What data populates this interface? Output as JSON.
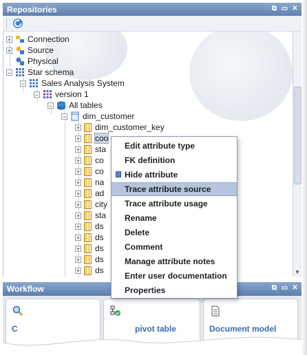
{
  "repositories_panel": {
    "title": "Repositories"
  },
  "tree": {
    "nodes": [
      {
        "label": "Connection",
        "icon": "connection-icon"
      },
      {
        "label": "Source",
        "icon": "source-icon"
      },
      {
        "label": "Physical",
        "icon": "physical-icon"
      },
      {
        "label": "Star schema",
        "icon": "star-schema-icon"
      },
      {
        "label": "Sales Analysis System",
        "icon": "star-schema-icon"
      },
      {
        "label": "version 1",
        "icon": "version-icon"
      },
      {
        "label": "All tables",
        "icon": "tables-icon"
      },
      {
        "label": "dim_customer",
        "icon": "table-icon"
      }
    ],
    "columns": [
      "dim_customer_key",
      "coo",
      "sta",
      "co",
      "co",
      "na",
      "ad",
      "city",
      "sta",
      "ds",
      "ds",
      "ds",
      "ds",
      "ds"
    ]
  },
  "context_menu": {
    "items": [
      {
        "label": "Edit attribute type"
      },
      {
        "label": "FK definition"
      },
      {
        "label": "Hide attribute",
        "icon": "hide-attribute-icon"
      },
      {
        "label": "Trace attribute source",
        "highlighted": true
      },
      {
        "label": "Trace attribute usage"
      },
      {
        "label": "Rename"
      },
      {
        "label": "Delete"
      },
      {
        "label": "Comment"
      },
      {
        "label": "Manage attribute notes"
      },
      {
        "label": "Enter user documentation"
      },
      {
        "label": "Properties"
      }
    ]
  },
  "workflow_panel": {
    "title": "Workflow",
    "cards": [
      {
        "label": "C",
        "icon": "search-icon"
      },
      {
        "label": "pivot table",
        "icon": "pivot-table-icon"
      },
      {
        "label": "Document model",
        "icon": "document-icon"
      }
    ]
  },
  "colors": {
    "header": "#6f8fbf",
    "highlight": "#b5c5dd",
    "link": "#3a6bb0"
  }
}
